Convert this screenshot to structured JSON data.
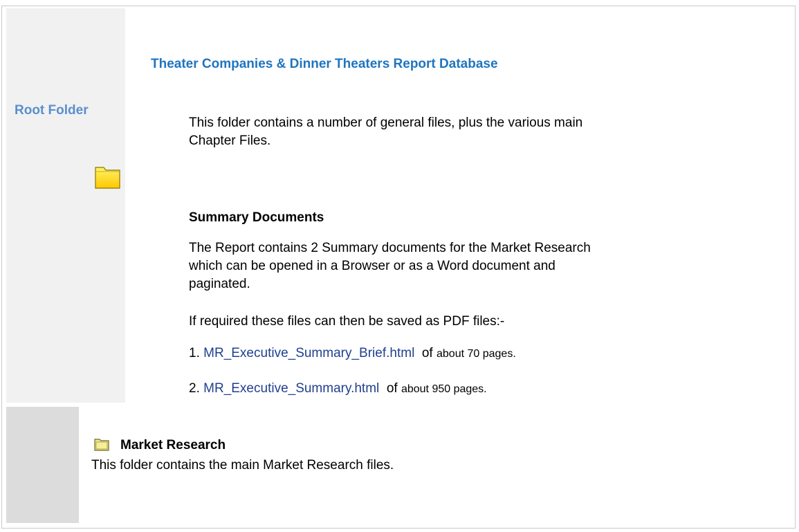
{
  "header": {
    "title": "Theater Companies & Dinner Theaters Report Database"
  },
  "sidebar": {
    "root_label": "Root Folder"
  },
  "root_section": {
    "intro_text": "This folder contains a number of general files, plus the various main Chapter Files."
  },
  "summary": {
    "heading": "Summary Documents",
    "body": "The Report contains 2 Summary documents for the Market Research which can be opened in a Browser or as a Word document and paginated.",
    "pdf_note": "If required these files can then be saved as PDF files:-",
    "items": [
      {
        "number": "1.",
        "link_text": "MR_Executive_Summary_Brief.html",
        "of_word": "of",
        "pages_text": "about 70 pages."
      },
      {
        "number": "2.",
        "link_text": "MR_Executive_Summary.html",
        "of_word": "of",
        "pages_text": "about 950 pages."
      }
    ]
  },
  "market_research": {
    "heading": "Market Research",
    "body": "This folder contains the main Market Research files."
  },
  "colors": {
    "title_blue": "#1f74c0",
    "root_label_blue": "#5a8fcf",
    "link_blue": "#1f3f8f",
    "folder_yellow": "#ffd000",
    "panel_light_gray": "#f1f1f1",
    "panel_gray": "#dcdcdc"
  }
}
